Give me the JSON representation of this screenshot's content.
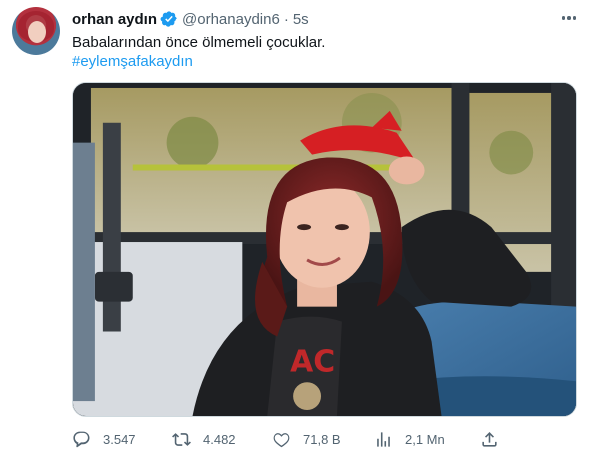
{
  "author": {
    "display_name": "orhan aydın",
    "handle": "@orhanaydin6",
    "separator": "·",
    "time": "5s",
    "verified": true
  },
  "tweet": {
    "text": "Babalarından önce ölmemeli çocuklar.",
    "hashtag": "#eylemşafakaydın"
  },
  "actions": {
    "replies": "3.547",
    "retweets": "4.482",
    "likes": "71,8 B",
    "views": "2,1 Mn"
  },
  "icons": {
    "verified": "verified-badge-icon",
    "more": "more-options-icon",
    "reply": "reply-icon",
    "retweet": "retweet-icon",
    "like": "heart-icon",
    "views": "analytics-icon",
    "share": "share-icon"
  },
  "colors": {
    "accent": "#1d9bf0",
    "muted": "#536471",
    "text": "#0f1419"
  }
}
